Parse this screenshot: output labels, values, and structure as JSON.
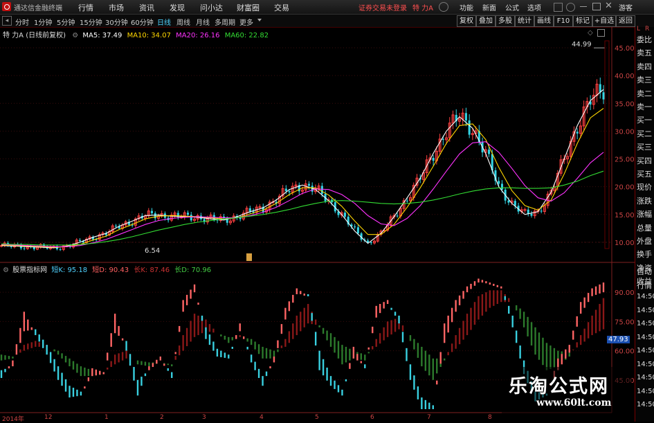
{
  "menubar": {
    "app_title": "通达信金融终端",
    "items": [
      "行情",
      "市场",
      "资讯",
      "发现",
      "问小达",
      "财富圈",
      "交易"
    ],
    "status": "证券交易未登录",
    "stock": "特 力A",
    "right_items": [
      "功能",
      "新面",
      "公式",
      "选项"
    ],
    "user": "游客"
  },
  "toolbar": {
    "periods": [
      "分时",
      "1分钟",
      "5分钟",
      "15分钟",
      "30分钟",
      "60分钟",
      "日线",
      "周线",
      "月线",
      "多周期",
      "更多"
    ],
    "active_period": "日线",
    "right_buttons": [
      "复权",
      "叠加",
      "多股",
      "统计",
      "画线",
      "F10",
      "标记",
      "+自选",
      "返回"
    ]
  },
  "main_chart": {
    "title": "特 力A (日线前复权)",
    "ma": [
      {
        "label": "MA5: 37.49",
        "color": "#ffffff"
      },
      {
        "label": "MA10: 34.07",
        "color": "#ffd700"
      },
      {
        "label": "MA20: 26.16",
        "color": "#ff33ff"
      },
      {
        "label": "MA60: 22.82",
        "color": "#33dd33"
      }
    ],
    "high_label": "44.99",
    "low_label": "6.54"
  },
  "sub_chart": {
    "title": "股票指标网",
    "lines": [
      {
        "label": "短K: 95.18",
        "color": "#4fd2ff"
      },
      {
        "label": "短D: 90.43",
        "color": "#ff6060"
      },
      {
        "label": "长K: 87.46",
        "color": "#cc3333"
      },
      {
        "label": "长D: 70.96",
        "color": "#44cc44"
      }
    ],
    "current_value": "47.93"
  },
  "right_panel": {
    "top_labels": [
      "L",
      "R"
    ],
    "items": [
      "委比",
      "卖五",
      "卖四",
      "卖三",
      "卖二",
      "卖一",
      "买一",
      "买二",
      "买三",
      "买四",
      "买五",
      "现价",
      "涨跌",
      "涨幅",
      "总量",
      "外盘",
      "换手",
      "净资",
      "收益"
    ],
    "lower_items": [
      "自动",
      "行情",
      "14:50",
      "14:50",
      "14:50",
      "14:50",
      "14:50",
      "14:50",
      "14:50",
      "14:50",
      "14:50"
    ]
  },
  "time_axis": [
    "2014年",
    "12",
    "1",
    "2",
    "3",
    "4",
    "5",
    "6",
    "7",
    "8"
  ],
  "watermark": {
    "line1": "乐淘公式网",
    "line2": "www.60lt.com"
  },
  "chart_data": [
    {
      "type": "line",
      "title": "特 力A (日线前复权)",
      "y_ticks": [
        10,
        15,
        20,
        25,
        30,
        35,
        40,
        45
      ],
      "ylim": [
        7,
        47
      ],
      "series": [
        {
          "name": "MA5",
          "values": [
            9.4,
            9.3,
            9.2,
            9.1,
            9.0,
            9.3,
            10.0,
            10.9,
            11.6,
            12.9,
            13.8,
            14.8,
            14.9,
            14.7,
            14.6,
            14.5,
            14.2,
            14.0,
            14.6,
            15.5,
            16.2,
            17.6,
            19.5,
            20.3,
            19.5,
            17.5,
            15.0,
            12.0,
            9.8,
            11.6,
            14.6,
            18.0,
            21.5,
            26.0,
            30.0,
            32.6,
            30.5,
            26.0,
            20.0,
            17.0,
            15.0,
            15.5,
            19.0,
            25.0,
            31.0,
            35.5,
            37.5
          ]
        },
        {
          "name": "MA10",
          "values": [
            9.5,
            9.4,
            9.3,
            9.2,
            9.1,
            9.2,
            9.6,
            10.4,
            11.1,
            12.3,
            13.2,
            14.2,
            14.7,
            14.8,
            14.7,
            14.6,
            14.4,
            14.2,
            14.4,
            15.1,
            15.8,
            17.0,
            18.6,
            19.8,
            19.8,
            18.5,
            16.5,
            13.8,
            11.4,
            11.4,
            13.2,
            16.3,
            19.8,
            23.7,
            27.8,
            31.0,
            31.3,
            28.5,
            23.5,
            19.3,
            16.6,
            15.8,
            17.6,
            22.3,
            27.8,
            32.4,
            34.1
          ]
        },
        {
          "name": "MA20",
          "values": [
            9.6,
            9.5,
            9.4,
            9.3,
            9.2,
            9.2,
            9.4,
            9.9,
            10.5,
            11.4,
            12.3,
            13.2,
            13.9,
            14.3,
            14.5,
            14.6,
            14.5,
            14.4,
            14.4,
            14.8,
            15.4,
            16.3,
            17.5,
            18.8,
            19.6,
            19.5,
            18.6,
            17.0,
            14.8,
            13.3,
            13.0,
            14.3,
            16.6,
            19.6,
            22.8,
            25.9,
            27.9,
            28.1,
            26.2,
            23.3,
            20.2,
            18.0,
            17.4,
            18.9,
            21.5,
            24.3,
            26.2
          ]
        },
        {
          "name": "MA60",
          "values": [
            9.7,
            9.6,
            9.6,
            9.5,
            9.5,
            9.5,
            9.6,
            9.8,
            10.1,
            10.5,
            11.0,
            11.6,
            12.2,
            12.7,
            13.2,
            13.6,
            13.9,
            14.2,
            14.4,
            14.7,
            15.0,
            15.4,
            15.9,
            16.5,
            17.0,
            17.4,
            17.5,
            17.4,
            17.2,
            17.0,
            16.9,
            17.0,
            17.2,
            17.6,
            18.1,
            18.7,
            19.2,
            19.6,
            19.8,
            19.8,
            19.7,
            19.7,
            19.8,
            20.3,
            21.0,
            22.0,
            22.8
          ]
        }
      ]
    },
    {
      "type": "line",
      "title": "股票指标网",
      "y_ticks": [
        45.0,
        60.0,
        75.0,
        90.0
      ],
      "ylim": [
        30,
        100
      ],
      "series": [
        {
          "name": "短K",
          "values": [
            46,
            55,
            80,
            68,
            58,
            45,
            36,
            37,
            51,
            49,
            79,
            60,
            37,
            52,
            57,
            46,
            86,
            94,
            66,
            57,
            56,
            74,
            54,
            42,
            57,
            82,
            92,
            88,
            50,
            42,
            37,
            62,
            51,
            83,
            86,
            74,
            45,
            30,
            30,
            74,
            86,
            93,
            97,
            95,
            93,
            72,
            48,
            34,
            37,
            56,
            63,
            85,
            92,
            95
          ]
        },
        {
          "name": "短D",
          "values": [
            50,
            52,
            70,
            71,
            63,
            52,
            42,
            39,
            47,
            48,
            69,
            65,
            45,
            50,
            55,
            49,
            80,
            90,
            72,
            61,
            58,
            70,
            58,
            47,
            54,
            76,
            89,
            89,
            60,
            47,
            40,
            56,
            53,
            77,
            84,
            78,
            53,
            36,
            32,
            64,
            80,
            90,
            95,
            95,
            93,
            78,
            55,
            39,
            38,
            50,
            59,
            79,
            88,
            90
          ]
        },
        {
          "name": "长K",
          "values": [
            55,
            56,
            63,
            65,
            63,
            58,
            52,
            47,
            47,
            48,
            58,
            60,
            53,
            52,
            54,
            52,
            68,
            79,
            76,
            69,
            64,
            68,
            63,
            56,
            56,
            66,
            78,
            84,
            72,
            62,
            53,
            56,
            55,
            66,
            75,
            77,
            65,
            52,
            45,
            55,
            68,
            79,
            88,
            91,
            91,
            85,
            72,
            58,
            50,
            52,
            57,
            68,
            78,
            87
          ]
        },
        {
          "name": "长D",
          "values": [
            58,
            57,
            60,
            62,
            62,
            60,
            56,
            52,
            50,
            49,
            53,
            56,
            55,
            54,
            54,
            53,
            60,
            67,
            70,
            69,
            67,
            67,
            66,
            62,
            60,
            62,
            68,
            74,
            73,
            69,
            63,
            60,
            58,
            62,
            67,
            71,
            68,
            62,
            56,
            56,
            61,
            68,
            76,
            82,
            85,
            85,
            80,
            72,
            64,
            60,
            59,
            63,
            68,
            71
          ]
        }
      ]
    }
  ]
}
